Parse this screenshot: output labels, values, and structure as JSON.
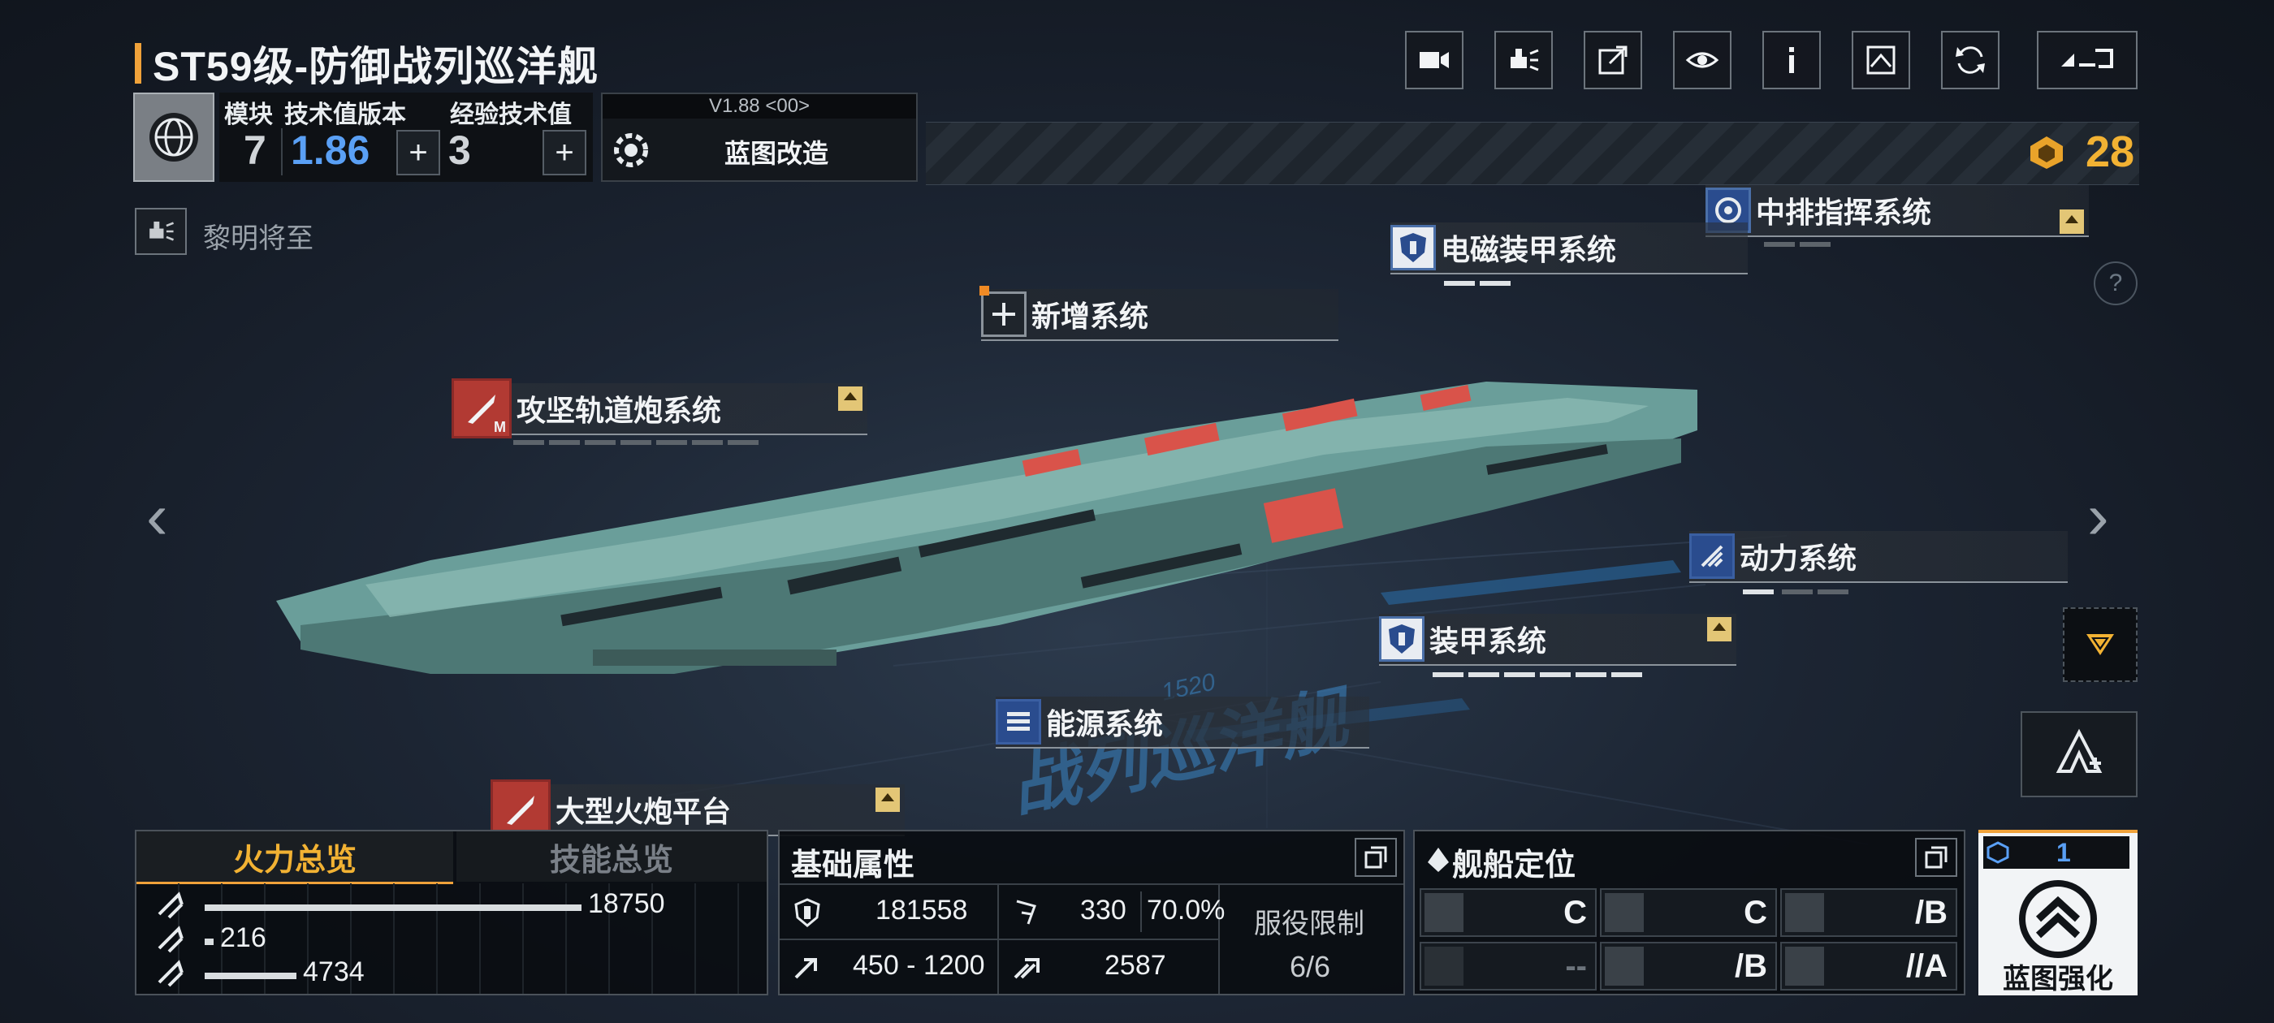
{
  "ship": {
    "title": "ST59级-防御战列巡洋舰",
    "module_label": "模块",
    "module_value": "7",
    "version_label": "技术值版本",
    "version_value": "1.86",
    "exp_label": "经验技术值",
    "exp_value": "3",
    "bp_version": "V1.88 <00>",
    "bp_modify_label": "蓝图改造",
    "currency_value": "28",
    "faction_name": "黎明将至",
    "watermark_number": "1520",
    "watermark_text": "战列巡洋舰"
  },
  "top_buttons": [
    {
      "name": "camera-button",
      "icon": "video-camera-icon"
    },
    {
      "name": "faction-button",
      "icon": "faction-icon"
    },
    {
      "name": "share-button",
      "icon": "share-icon"
    },
    {
      "name": "view-button",
      "icon": "eye-icon"
    },
    {
      "name": "info-button",
      "icon": "info-icon"
    },
    {
      "name": "blueprint-button",
      "icon": "blueprint-icon"
    },
    {
      "name": "refresh-button",
      "icon": "refresh-icon"
    },
    {
      "name": "back-button",
      "icon": "back-icon"
    }
  ],
  "systems": [
    {
      "label": "中排指挥系统"
    },
    {
      "label": "电磁装甲系统"
    },
    {
      "label": "新增系统"
    },
    {
      "label": "攻坚轨道炮系统",
      "tag": "M"
    },
    {
      "label": "动力系统"
    },
    {
      "label": "装甲系统"
    },
    {
      "label": "能源系统"
    },
    {
      "label": "大型火炮平台"
    }
  ],
  "tabs": {
    "firepower": "火力总览",
    "skills": "技能总览"
  },
  "firepower": {
    "rows": [
      {
        "value": "18750",
        "fraction": 0.86
      },
      {
        "value": "216",
        "fraction": 0.02
      },
      {
        "value": "4734",
        "fraction": 0.21
      }
    ]
  },
  "basic": {
    "title": "基础属性",
    "hp": "181558",
    "evade": "330",
    "evade_pct": "70.0%",
    "range": "450 - 1200",
    "speed": "2587",
    "service_label": "服役限制",
    "service_value": "6/6"
  },
  "role": {
    "title": "舰船定位",
    "grades": [
      "C",
      "C",
      "/B",
      "--",
      "/B",
      "//A"
    ]
  },
  "enhance": {
    "count": "1",
    "label": "蓝图强化"
  },
  "colors": {
    "accent": "#f0a23a",
    "gold": "#f2b233",
    "blue_value": "#5aa0f5"
  }
}
